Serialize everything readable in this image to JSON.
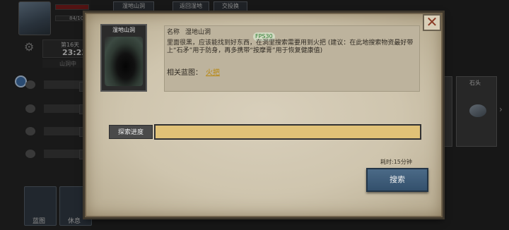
{
  "background": {
    "top_tabs": [
      "湿地山洞",
      "返回湿地",
      "交投换"
    ],
    "sp_text": "84/10",
    "day_text": "第16天",
    "time_text": "23:23",
    "location_text": "山洞中",
    "bottom_buttons": [
      {
        "label": "蓝图"
      },
      {
        "label": "休息"
      }
    ],
    "right_card_title": "石头"
  },
  "dialog": {
    "thumbnail_title": "湿地山洞",
    "name_label": "名称",
    "name_value": "湿地山洞",
    "fps_text": "FPS30",
    "description": "里面很黑，应该能找到好东西，在洞里搜索需要用到火把 (建议：在此地搜索物资最好带上“石矛”用于防身，再多携带“按摩膏”用于恢复健康值)",
    "blueprint_label": "相关蓝图：",
    "blueprint_link": "火把",
    "progress_label": "探索进度",
    "progress_fraction": 1.0,
    "progress_color": "#e1c277",
    "time_cost": "耗时:15分钟",
    "search_button": "搜索",
    "close_icon": "close-icon"
  }
}
